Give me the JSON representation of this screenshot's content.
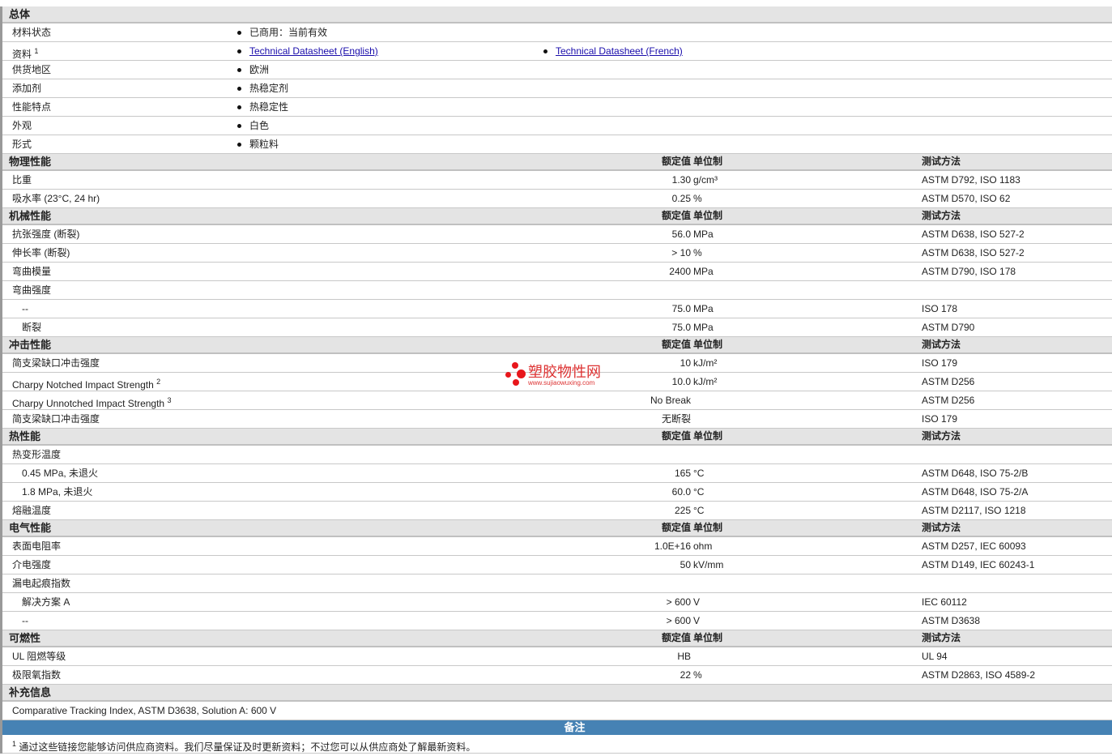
{
  "general": {
    "title": "总体",
    "rows": [
      {
        "label": "材料状态",
        "value": "已商用：当前有效"
      },
      {
        "label": "资料",
        "sup": "1",
        "link1": "Technical Datasheet (English)",
        "link2": "Technical Datasheet (French)"
      },
      {
        "label": "供货地区",
        "value": "欧洲"
      },
      {
        "label": "添加剂",
        "value": "热稳定剂"
      },
      {
        "label": "性能特点",
        "value": "热稳定性"
      },
      {
        "label": "外观",
        "value": "白色"
      },
      {
        "label": "形式",
        "value": "颗粒料"
      }
    ]
  },
  "col_headers": {
    "value": "额定值",
    "unit": "单位制",
    "method": "测试方法"
  },
  "sections": [
    {
      "title": "物理性能",
      "rows": [
        {
          "label": "比重",
          "value": "1.30",
          "unit": "g/cm³",
          "method": "ASTM D792, ISO 1183"
        },
        {
          "label": "吸水率 (23°C, 24 hr)",
          "value": "0.25",
          "unit": "%",
          "method": "ASTM D570, ISO 62"
        }
      ]
    },
    {
      "title": "机械性能",
      "rows": [
        {
          "label": "抗张强度 (断裂)",
          "value": "56.0",
          "unit": "MPa",
          "method": "ASTM D638, ISO 527-2"
        },
        {
          "label": "伸长率 (断裂)",
          "value": "> 10",
          "unit": "%",
          "method": "ASTM D638, ISO 527-2"
        },
        {
          "label": "弯曲模量",
          "value": "2400",
          "unit": "MPa",
          "method": "ASTM D790, ISO 178"
        },
        {
          "label": "弯曲强度"
        },
        {
          "label": "--",
          "sub": true,
          "value": "75.0",
          "unit": "MPa",
          "method": "ISO 178"
        },
        {
          "label": "断裂",
          "sub": true,
          "value": "75.0",
          "unit": "MPa",
          "method": "ASTM D790"
        }
      ]
    },
    {
      "title": "冲击性能",
      "rows": [
        {
          "label": "简支梁缺口冲击强度",
          "value": "10",
          "unit": "kJ/m²",
          "method": "ISO 179"
        },
        {
          "label": "Charpy Notched Impact Strength",
          "sup": "2",
          "value": "10.0",
          "unit": "kJ/m²",
          "method": "ASTM D256"
        },
        {
          "label": "Charpy Unnotched Impact Strength",
          "sup": "3",
          "value": "No Break",
          "method": "ASTM D256"
        },
        {
          "label": "简支梁缺口冲击强度",
          "value": "无断裂",
          "method": "ISO 179"
        }
      ]
    },
    {
      "title": "热性能",
      "rows": [
        {
          "label": "热变形温度"
        },
        {
          "label": "0.45 MPa, 未退火",
          "sub": true,
          "value": "165",
          "unit": "°C",
          "method": "ASTM D648, ISO 75-2/B"
        },
        {
          "label": "1.8 MPa, 未退火",
          "sub": true,
          "value": "60.0",
          "unit": "°C",
          "method": "ASTM D648, ISO 75-2/A"
        },
        {
          "label": "熔融温度",
          "value": "225",
          "unit": "°C",
          "method": "ASTM D2117, ISO 1218"
        }
      ]
    },
    {
      "title": "电气性能",
      "rows": [
        {
          "label": "表面电阻率",
          "value": "1.0E+16",
          "unit": "ohm",
          "method": "ASTM D257, IEC 60093"
        },
        {
          "label": "介电强度",
          "value": "50",
          "unit": "kV/mm",
          "method": "ASTM D149, IEC 60243-1"
        },
        {
          "label": "漏电起痕指数"
        },
        {
          "label": "解决方案 A",
          "sub": true,
          "value": "> 600",
          "unit": "V",
          "method": "IEC 60112"
        },
        {
          "label": "--",
          "sub": true,
          "value": "> 600",
          "unit": "V",
          "method": "ASTM D3638"
        }
      ]
    },
    {
      "title": "可燃性",
      "rows": [
        {
          "label": "UL 阻燃等级",
          "value": "HB",
          "method": "UL 94"
        },
        {
          "label": "极限氧指数",
          "value": "22",
          "unit": "%",
          "method": "ASTM D2863, ISO 4589-2"
        }
      ]
    }
  ],
  "supplement": {
    "title": "补充信息",
    "text": "Comparative Tracking Index, ASTM D3638, Solution A: 600 V"
  },
  "notes": {
    "title": "备注",
    "items": [
      {
        "sup": "1",
        "text": "通过这些链接您能够访问供应商资料。我们尽量保证及时更新资料；不过您可以从供应商处了解最新资料。"
      }
    ]
  },
  "watermark": {
    "text": "塑胶物性网",
    "url": "www.sujiaowuxing.com"
  }
}
